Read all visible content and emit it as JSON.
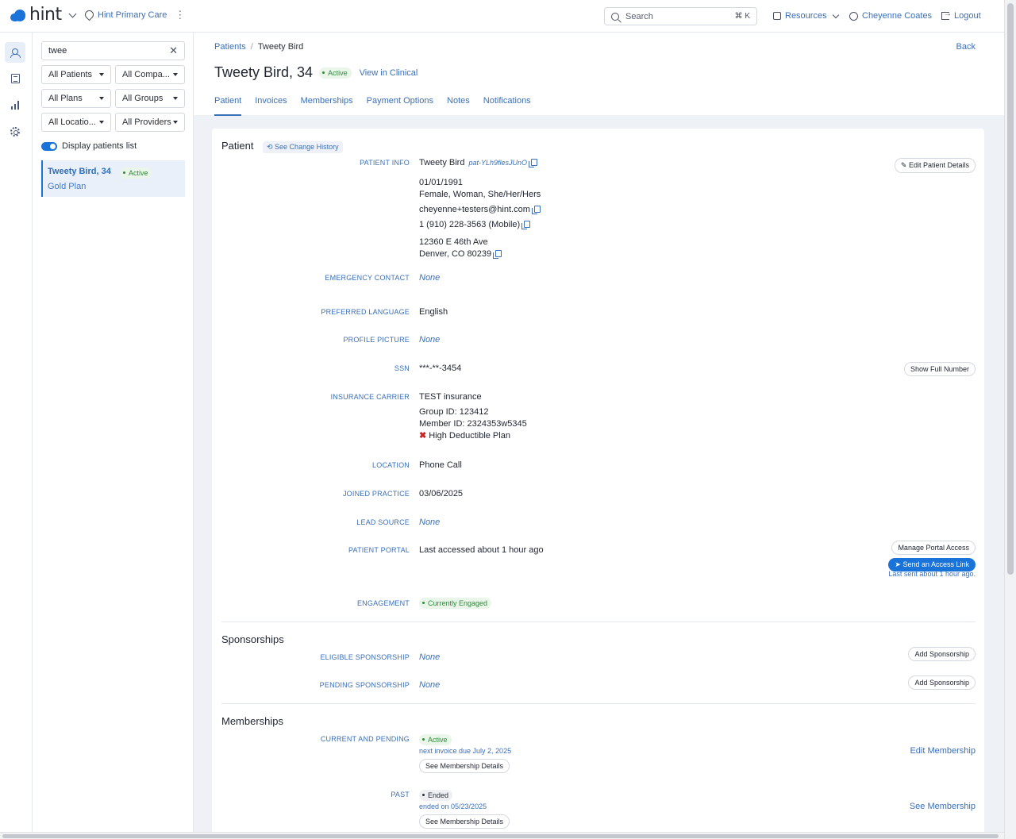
{
  "topbar": {
    "logo_text": "hint",
    "practice_name": "Hint Primary Care",
    "search_placeholder": "Search",
    "search_shortcut": "⌘ K",
    "resources_label": "Resources",
    "user_name": "Cheyenne Coates",
    "logout_label": "Logout"
  },
  "filters": {
    "search_value": "twee",
    "dropdowns": [
      "All Patients",
      "All Compa...",
      "All Plans",
      "All Groups",
      "All Locatio...",
      "All Providers"
    ],
    "toggle_label": "Display patients list"
  },
  "patient_list": [
    {
      "name": "Tweety Bird, 34",
      "status": "Active",
      "plan": "Gold Plan"
    }
  ],
  "header": {
    "breadcrumb_root": "Patients",
    "breadcrumb_current": "Tweety Bird",
    "back_label": "Back",
    "title": "Tweety Bird, 34",
    "status": "Active",
    "clinical_link": "View in Clinical",
    "tabs": [
      "Patient",
      "Invoices",
      "Memberships",
      "Payment Options",
      "Notes",
      "Notifications"
    ]
  },
  "patient": {
    "section_title": "Patient",
    "history_link": "See Change History",
    "edit_button": "Edit Patient Details",
    "labels": {
      "info": "PATIENT INFO",
      "emergency": "EMERGENCY CONTACT",
      "language": "PREFERRED LANGUAGE",
      "picture": "PROFILE PICTURE",
      "ssn": "SSN",
      "insurance": "INSURANCE CARRIER",
      "location": "LOCATION",
      "joined": "JOINED PRACTICE",
      "lead": "LEAD SOURCE",
      "portal": "PATIENT PORTAL",
      "engagement": "ENGAGEMENT"
    },
    "name": "Tweety Bird",
    "patient_id": "pat-YLh9flesJUnO",
    "dob": "01/01/1991",
    "gender": "Female, Woman, She/Her/Hers",
    "email": "cheyenne+testers@hint.com",
    "phone": "1 (910) 228-3563 (Mobile)",
    "address_line1": "12360 E 46th Ave",
    "address_line2": "Denver, CO 80239",
    "emergency_contact": "None",
    "language": "English",
    "profile_picture": "None",
    "ssn": "***-**-3454",
    "ssn_button": "Show Full Number",
    "insurance_carrier": "TEST insurance",
    "group_id": "Group ID: 123412",
    "member_id": "Member ID: 2324353w5345",
    "high_deductible": "High Deductible Plan",
    "location": "Phone Call",
    "joined_practice": "03/06/2025",
    "lead_source": "None",
    "portal_status": "Last accessed about 1 hour ago",
    "manage_portal_button": "Manage Portal Access",
    "send_link_button": "Send an Access Link",
    "last_sent": "Last sent about 1 hour ago.",
    "engagement": "Currently Engaged"
  },
  "sponsorships": {
    "section_title": "Sponsorships",
    "eligible_label": "ELIGIBLE SPONSORSHIP",
    "eligible_value": "None",
    "pending_label": "PENDING SPONSORSHIP",
    "pending_value": "None",
    "add_button": "Add Sponsorship"
  },
  "memberships": {
    "section_title": "Memberships",
    "current_label": "CURRENT AND PENDING",
    "current_status": "Active",
    "next_invoice": "next invoice due July 2, 2025",
    "details_button": "See Membership Details",
    "edit_link": "Edit Membership",
    "past_label": "PAST",
    "past_status": "Ended",
    "ended_on": "ended on 05/23/2025",
    "see_link": "See Membership"
  },
  "colors": {
    "accent": "#1a73d9",
    "link": "#3b6fb6",
    "active_green": "#2f8a3a",
    "background": "#eef1f6"
  }
}
